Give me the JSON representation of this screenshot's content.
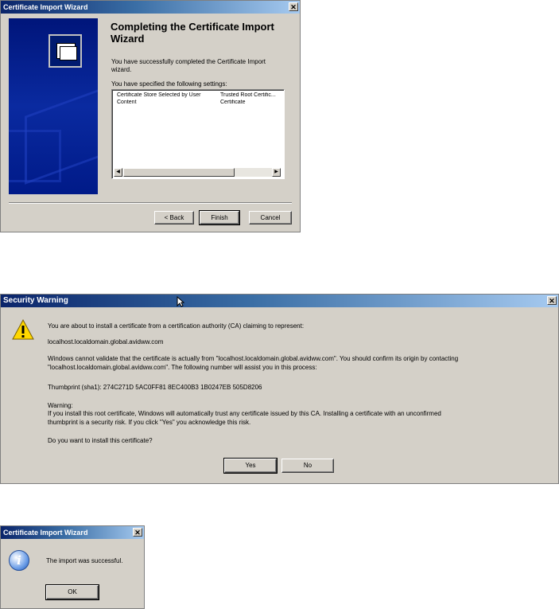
{
  "wizard": {
    "title": "Certificate Import Wizard",
    "heading": "Completing the Certificate Import Wizard",
    "intro": "You have successfully completed the Certificate Import wizard.",
    "settings_label": "You have specified the following settings:",
    "settings": [
      {
        "name": "Certificate Store Selected by User",
        "value": "Trusted Root Certific..."
      },
      {
        "name": "Content",
        "value": "Certificate"
      }
    ],
    "buttons": {
      "back": "< Back",
      "finish": "Finish",
      "cancel": "Cancel"
    }
  },
  "security": {
    "title": "Security Warning",
    "line1": "You are about to install a certificate from a certification authority (CA) claiming to represent:",
    "host": "localhost.localdomain.global.avidww.com",
    "validate_1": "Windows cannot validate that the certificate is actually from \"localhost.localdomain.global.avidww.com\". You should confirm its origin by contacting",
    "validate_2": "\"localhost.localdomain.global.avidww.com\". The following number will assist you in this process:",
    "thumbprint": "Thumbprint (sha1): 274C271D 5AC0FF81 8EC400B3 1B0247EB 505D8206",
    "warning_label": "Warning:",
    "warning_1": "If you install this root certificate, Windows will automatically trust any certificate issued by this CA. Installing a certificate with an unconfirmed",
    "warning_2": "thumbprint is a security risk. If you click \"Yes\" you acknowledge this risk.",
    "question": "Do you want to install this certificate?",
    "buttons": {
      "yes": "Yes",
      "no": "No"
    }
  },
  "success": {
    "title": "Certificate Import Wizard",
    "message": "The import was successful.",
    "ok": "OK"
  },
  "icons": {
    "close": "close-icon",
    "warning": "warning-icon",
    "info": "info-icon",
    "certificate": "certificate-icon"
  }
}
